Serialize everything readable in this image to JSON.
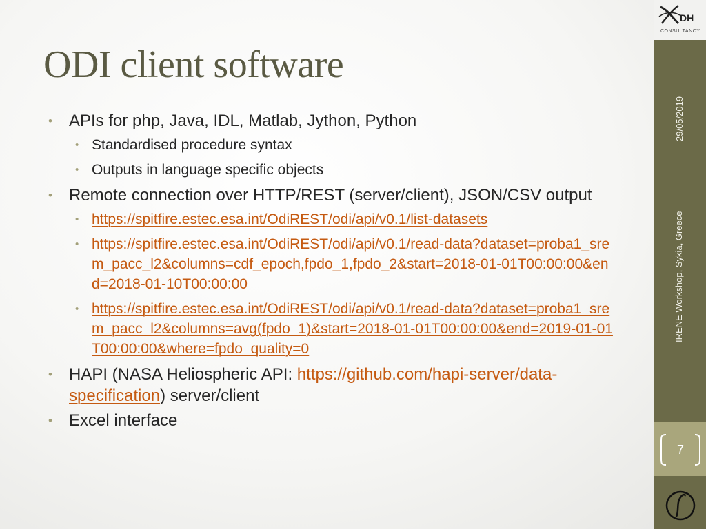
{
  "slide": {
    "title": "ODI client software",
    "date": "29/05/2019",
    "event": "IRENE Workshop, Sykia, Greece",
    "page_number": "7"
  },
  "logo": {
    "text": "DH",
    "subtext": "CONSULTANCY"
  },
  "bullets": {
    "b1": "APIs for php, Java, IDL, Matlab, Jython, Python",
    "b1_sub1": "Standardised procedure syntax",
    "b1_sub2": "Outputs in language specific objects",
    "b2": "Remote connection over HTTP/REST (server/client), JSON/CSV output",
    "b2_link1": "https://spitfire.estec.esa.int/OdiREST/odi/api/v0.1/list-datasets",
    "b2_link2": "https://spitfire.estec.esa.int/OdiREST/odi/api/v0.1/read-data?dataset=proba1_srem_pacc_l2&columns=cdf_epoch,fpdo_1,fpdo_2&start=2018-01-01T00:00:00&end=2018-01-10T00:00:00",
    "b2_link3": "https://spitfire.estec.esa.int/OdiREST/odi/api/v0.1/read-data?dataset=proba1_srem_pacc_l2&columns=avg(fpdo_1)&start=2018-01-01T00:00:00&end=2019-01-01T00:00:00&where=fpdo_quality=0",
    "b3_prefix": "HAPI (NASA Heliospheric API: ",
    "b3_link": "https://github.com/hapi-server/data-specification",
    "b3_suffix": ") server/client",
    "b4": "Excel interface"
  },
  "colors": {
    "title": "#5a5a43",
    "bullet": "#a3a07a",
    "link": "#c55a11",
    "sidebar": "#6b6a48",
    "page_box": "#a9a67c"
  },
  "icons": [
    "bullet-dot-icon",
    "dh-logo-icon",
    "page-bracket-icon",
    "wave-logo-icon"
  ]
}
